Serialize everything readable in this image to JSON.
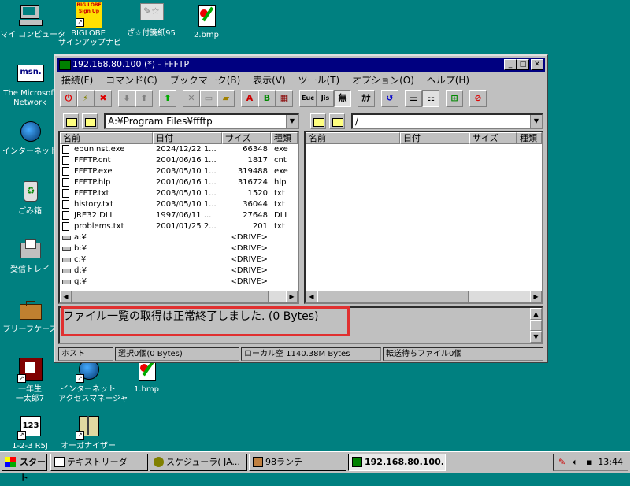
{
  "desktop": {
    "icons": [
      {
        "label": "マイ コンピュータ"
      },
      {
        "label": "BIGLOBE",
        "label2": "サインアップナビ",
        "badge": "BIG LOBE Sign Up"
      },
      {
        "label": "ざ☆付箋紙95"
      },
      {
        "label": "2.bmp"
      },
      {
        "label": "The Microsoft",
        "label2": "Network",
        "badge": "msn."
      },
      {
        "label": "インターネット"
      },
      {
        "label": "ごみ箱"
      },
      {
        "label": "受信トレイ"
      },
      {
        "label": "ブリーフケース"
      },
      {
        "label": "一年生",
        "label2": "一太郎7"
      },
      {
        "label": "インターネット",
        "label2": "アクセスマネージャ"
      },
      {
        "label": "1.bmp"
      },
      {
        "label": "1-2-3 R5J",
        "badge": "123"
      },
      {
        "label": "オーガナイザー"
      }
    ]
  },
  "window": {
    "title": "192.168.80.100 (*) - FFFTP",
    "menu": [
      "接続(F)",
      "コマンド(C)",
      "ブックマーク(B)",
      "表示(V)",
      "ツール(T)",
      "オプション(O)",
      "ヘルプ(H)"
    ],
    "toolbar_text": {
      "a": "A",
      "b": "B",
      "ex": "Euc",
      "jis": "Jis",
      "none": "無",
      "kana": "ｶﾅ"
    },
    "local": {
      "path": "A:¥Program Files¥ffftp",
      "columns": [
        "名前",
        "日付",
        "サイズ",
        "種類"
      ],
      "files": [
        {
          "name": "epuninst.exe",
          "date": "2024/12/22 1...",
          "size": "66348",
          "type": "exe",
          "kind": "file"
        },
        {
          "name": "FFFTP.cnt",
          "date": "2001/06/16 1...",
          "size": "1817",
          "type": "cnt",
          "kind": "file"
        },
        {
          "name": "FFFTP.exe",
          "date": "2003/05/10 1...",
          "size": "319488",
          "type": "exe",
          "kind": "file"
        },
        {
          "name": "FFFTP.hlp",
          "date": "2001/06/16 1...",
          "size": "316724",
          "type": "hlp",
          "kind": "file"
        },
        {
          "name": "FFFTP.txt",
          "date": "2003/05/10 1...",
          "size": "1520",
          "type": "txt",
          "kind": "file"
        },
        {
          "name": "history.txt",
          "date": "2003/05/10 1...",
          "size": "36044",
          "type": "txt",
          "kind": "file"
        },
        {
          "name": "JRE32.DLL",
          "date": "1997/06/11 ...",
          "size": "27648",
          "type": "DLL",
          "kind": "file"
        },
        {
          "name": "problems.txt",
          "date": "2001/01/25 2...",
          "size": "201",
          "type": "txt",
          "kind": "file"
        },
        {
          "name": "a:¥",
          "date": "",
          "size": "<DRIVE>",
          "type": "",
          "kind": "drive"
        },
        {
          "name": "b:¥",
          "date": "",
          "size": "<DRIVE>",
          "type": "",
          "kind": "drive"
        },
        {
          "name": "c:¥",
          "date": "",
          "size": "<DRIVE>",
          "type": "",
          "kind": "drive"
        },
        {
          "name": "d:¥",
          "date": "",
          "size": "<DRIVE>",
          "type": "",
          "kind": "drive"
        },
        {
          "name": "q:¥",
          "date": "",
          "size": "<DRIVE>",
          "type": "",
          "kind": "drive"
        }
      ]
    },
    "remote": {
      "path": "/",
      "columns": [
        "名前",
        "日付",
        "サイズ",
        "種類"
      ]
    },
    "message": "ファイル一覧の取得は正常終了しました. (0 Bytes)",
    "status": [
      "ホスト",
      "選択0個(0 Bytes)",
      "ローカル空 1140.38M Bytes",
      "転送待ちファイル0個"
    ]
  },
  "taskbar": {
    "start": "スタート",
    "tasks": [
      "テキストリーダ",
      "スケジューラ( JA...",
      "98ランチ",
      "192.168.80.100..."
    ],
    "clock": "13:44"
  },
  "colors": {
    "desktop": "#008080",
    "titlebar": "#000080",
    "highlight": "#e03030"
  }
}
